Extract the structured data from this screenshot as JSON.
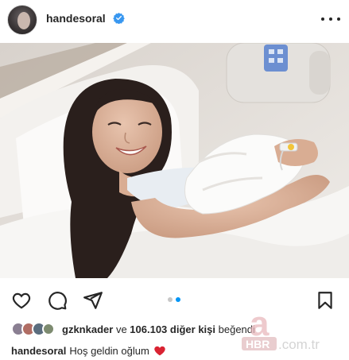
{
  "post": {
    "username": "handesoral",
    "verified": true,
    "more_icon": "more-horizontal-icon"
  },
  "image": {
    "description_alt": ""
  },
  "actions": {
    "like_icon": "heart-outline-icon",
    "comment_icon": "comment-icon",
    "share_icon": "send-icon",
    "save_icon": "bookmark-icon",
    "carousel_index": 2,
    "carousel_total": 2
  },
  "likes": {
    "first_liker": "gzknkader",
    "connector": "ve",
    "others_count": "106.103",
    "others_suffix": "diğer kişi",
    "action": "beğendi"
  },
  "caption": {
    "username": "handesoral",
    "text": "Hoş geldin oğlum",
    "emoji_icon": "red-heart-icon"
  },
  "watermark": {
    "brand": "HBR",
    "domain": ".com.tr",
    "brand_letter": "a"
  },
  "colors": {
    "accent": "#0095f6",
    "heart": "#e0245e",
    "watermark": "#d0d0d0"
  }
}
